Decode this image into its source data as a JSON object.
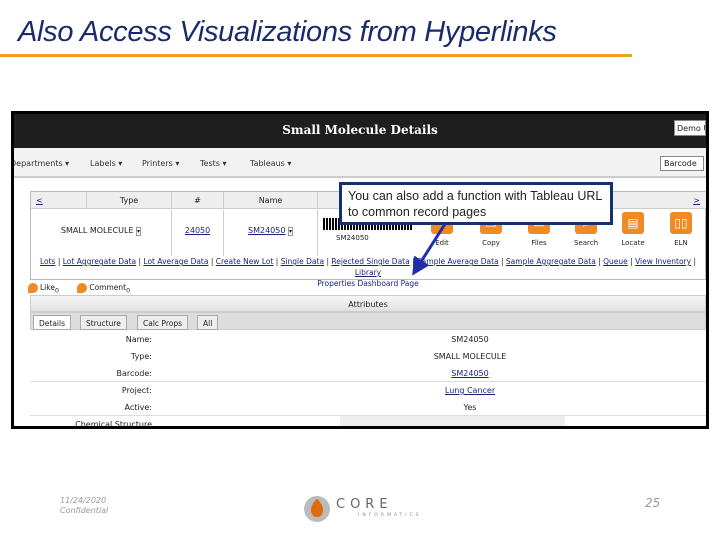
{
  "slide": {
    "title": "Also Access Visualizations from Hyperlinks",
    "date": "11/24/2020",
    "confidential": "Confidential",
    "page": "25",
    "logo_text": "CORE",
    "logo_sub": "INFORMATICS"
  },
  "app": {
    "header_title": "Small Molecule Details",
    "user_button": "Demo U",
    "nav": [
      "Departments ▾",
      "Labels ▾",
      "Printers ▾",
      "Tests ▾",
      "Tableaus ▾"
    ],
    "barcode_select": "Barcode",
    "record": {
      "prev": "<",
      "next": ">",
      "headers": {
        "type": "Type",
        "num": "#",
        "name": "Name"
      },
      "type": "SMALL MOLECULE",
      "num": "24050",
      "name": "SM24050",
      "barcode_text": "SM24050"
    },
    "actions": [
      "Edit",
      "Copy",
      "Files",
      "Search",
      "Locate",
      "ELN"
    ],
    "links": [
      "Lots",
      "Lot Aggregate Data",
      "Lot Average Data",
      "Create New Lot",
      "Single Data",
      "Rejected Single Data",
      "Sample Average Data",
      "Sample Aggregate Data",
      "Queue",
      "View Inventory",
      "Library",
      "Properties Dashboard Page"
    ],
    "like": "Like",
    "like_count": "0",
    "comment": "Comment",
    "comment_count": "0",
    "attributes_title": "Attributes",
    "tabs": [
      "Details",
      "Structure",
      "Calc Props",
      "All"
    ],
    "rows": [
      {
        "k": "Name:",
        "v": "SM24050"
      },
      {
        "k": "Type:",
        "v": "SMALL MOLECULE"
      },
      {
        "k": "Barcode:",
        "v": "SM24050"
      },
      {
        "k": "Project:",
        "v": "Lung Cancer"
      },
      {
        "k": "Active:",
        "v": "Yes"
      },
      {
        "k": "Chemical Structure",
        "v": ""
      }
    ]
  },
  "callout": "You can also add a function with Tableau URL to common record pages",
  "colors": {
    "accent": "#f0a020",
    "title": "#1a2b6b",
    "callout_border": "#15306e",
    "arrow": "#1f2fa8"
  }
}
